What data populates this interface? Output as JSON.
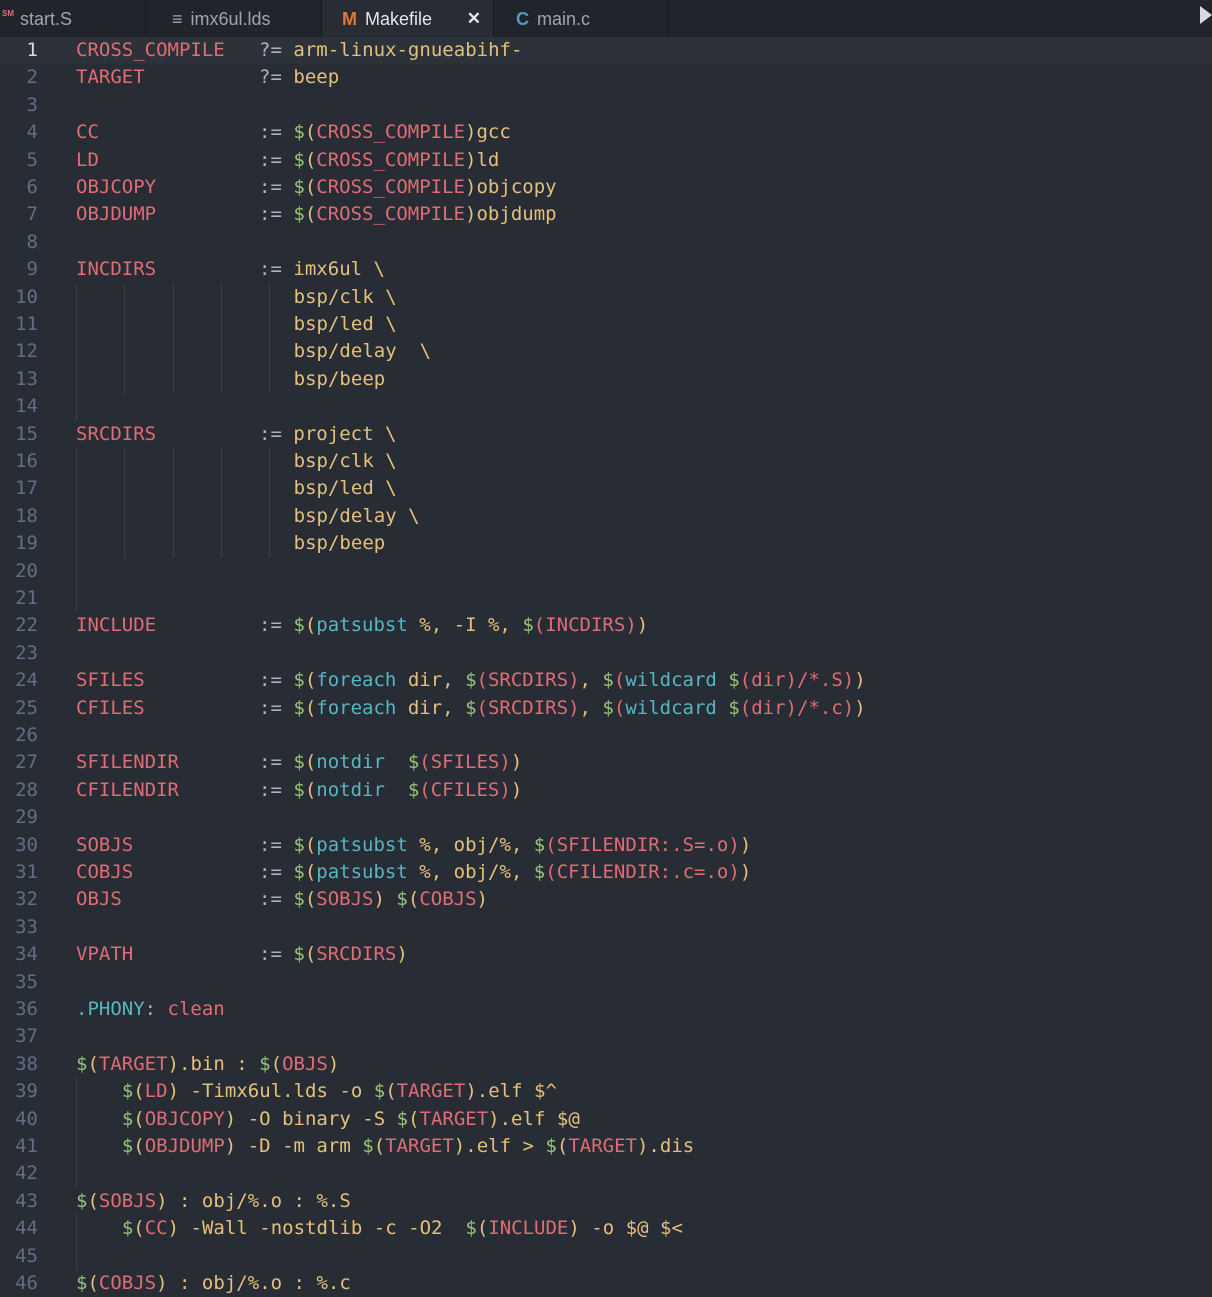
{
  "tabs": [
    {
      "label": "start.S",
      "icon": "SM"
    },
    {
      "label": "imx6ul.lds",
      "icon": "≡"
    },
    {
      "label": "Makefile",
      "icon": "M",
      "close": "✕"
    },
    {
      "label": "main.c",
      "icon": "C"
    }
  ],
  "accent": {
    "makefile_icon": "#e37933",
    "c_icon": "#519aba",
    "asm_icon": "#e06c75"
  },
  "lines": [
    {
      "n": "1",
      "code": "CROSS_COMPILE   ?= arm-linux-gnueabihf-"
    },
    {
      "n": "2",
      "code": "TARGET          ?= beep"
    },
    {
      "n": "3",
      "code": ""
    },
    {
      "n": "4",
      "code": "CC              := $(CROSS_COMPILE)gcc"
    },
    {
      "n": "5",
      "code": "LD              := $(CROSS_COMPILE)ld"
    },
    {
      "n": "6",
      "code": "OBJCOPY         := $(CROSS_COMPILE)objcopy"
    },
    {
      "n": "7",
      "code": "OBJDUMP         := $(CROSS_COMPILE)objdump"
    },
    {
      "n": "8",
      "code": ""
    },
    {
      "n": "9",
      "code": "INCDIRS         := imx6ul \\"
    },
    {
      "n": "10",
      "code": "                   bsp/clk \\"
    },
    {
      "n": "11",
      "code": "                   bsp/led \\"
    },
    {
      "n": "12",
      "code": "                   bsp/delay  \\"
    },
    {
      "n": "13",
      "code": "                   bsp/beep"
    },
    {
      "n": "14",
      "code": ""
    },
    {
      "n": "15",
      "code": "SRCDIRS         := project \\"
    },
    {
      "n": "16",
      "code": "                   bsp/clk \\"
    },
    {
      "n": "17",
      "code": "                   bsp/led \\"
    },
    {
      "n": "18",
      "code": "                   bsp/delay \\"
    },
    {
      "n": "19",
      "code": "                   bsp/beep"
    },
    {
      "n": "20",
      "code": ""
    },
    {
      "n": "21",
      "code": ""
    },
    {
      "n": "22",
      "code": "INCLUDE         := $(patsubst %, -I %, $(INCDIRS))"
    },
    {
      "n": "23",
      "code": ""
    },
    {
      "n": "24",
      "code": "SFILES          := $(foreach dir, $(SRCDIRS), $(wildcard $(dir)/*.S))"
    },
    {
      "n": "25",
      "code": "CFILES          := $(foreach dir, $(SRCDIRS), $(wildcard $(dir)/*.c))"
    },
    {
      "n": "26",
      "code": ""
    },
    {
      "n": "27",
      "code": "SFILENDIR       := $(notdir  $(SFILES))"
    },
    {
      "n": "28",
      "code": "CFILENDIR       := $(notdir  $(CFILES))"
    },
    {
      "n": "29",
      "code": ""
    },
    {
      "n": "30",
      "code": "SOBJS           := $(patsubst %, obj/%, $(SFILENDIR:.S=.o))"
    },
    {
      "n": "31",
      "code": "COBJS           := $(patsubst %, obj/%, $(CFILENDIR:.c=.o))"
    },
    {
      "n": "32",
      "code": "OBJS            := $(SOBJS) $(COBJS)"
    },
    {
      "n": "33",
      "code": ""
    },
    {
      "n": "34",
      "code": "VPATH           := $(SRCDIRS)"
    },
    {
      "n": "35",
      "code": ""
    },
    {
      "n": "36",
      "code": ".PHONY: clean"
    },
    {
      "n": "37",
      "code": ""
    },
    {
      "n": "38",
      "code": "$(TARGET).bin : $(OBJS)"
    },
    {
      "n": "39",
      "code": "    $(LD) -Timx6ul.lds -o $(TARGET).elf $^"
    },
    {
      "n": "40",
      "code": "    $(OBJCOPY) -O binary -S $(TARGET).elf $@"
    },
    {
      "n": "41",
      "code": "    $(OBJDUMP) -D -m arm $(TARGET).elf > $(TARGET).dis"
    },
    {
      "n": "42",
      "code": ""
    },
    {
      "n": "43",
      "code": "$(SOBJS) : obj/%.o : %.S"
    },
    {
      "n": "44",
      "code": "    $(CC) -Wall -nostdlib -c -O2  $(INCLUDE) -o $@ $<"
    },
    {
      "n": "45",
      "code": ""
    },
    {
      "n": "46",
      "code": "$(COBJS) : obj/%.o : %.c"
    }
  ]
}
